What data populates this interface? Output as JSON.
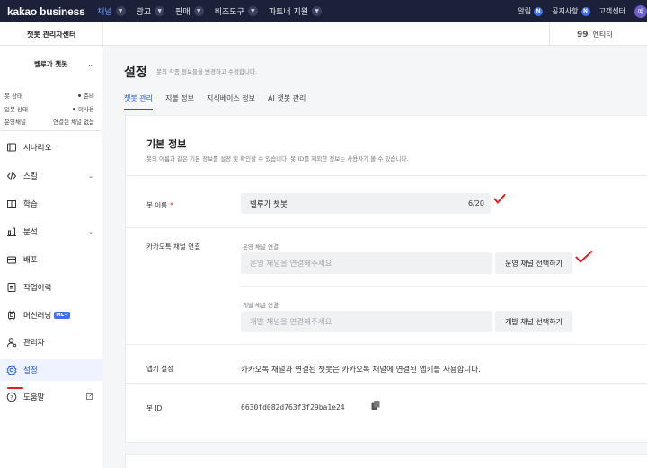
{
  "topnav": {
    "brand": "kakao business",
    "menu": [
      {
        "label": "채널",
        "active": true
      },
      {
        "label": "광고",
        "active": false
      },
      {
        "label": "판매",
        "active": false
      },
      {
        "label": "비즈도구",
        "active": false
      },
      {
        "label": "파트너 지원",
        "active": false
      }
    ],
    "right": {
      "alert_label": "알림",
      "alert_badge": "N",
      "notice_label": "공지사항",
      "notice_badge": "N",
      "support_label": "고객센터",
      "avatar_letter": "예"
    }
  },
  "subheader": {
    "admin_title": "챗봇 관리자센터",
    "entity_icon": "99",
    "entity_label": "엔티티"
  },
  "sidebar": {
    "bot_name": "벨루가 챗봇",
    "status": [
      {
        "label": "봇 상태",
        "value": "준비",
        "dot": true
      },
      {
        "label": "일봇 상태",
        "value": "미사용",
        "dot": true
      },
      {
        "label": "운영채널",
        "value": "연결된 채널 없음",
        "dot": false
      }
    ],
    "items": [
      {
        "label": "시나리오",
        "icon": "scenario-icon",
        "chevron": false,
        "active": false
      },
      {
        "label": "스킬",
        "icon": "code-icon",
        "chevron": true,
        "active": false
      },
      {
        "label": "학습",
        "icon": "book-icon",
        "chevron": false,
        "active": false
      },
      {
        "label": "분석",
        "icon": "chart-icon",
        "chevron": true,
        "active": false
      },
      {
        "label": "배포",
        "icon": "deploy-icon",
        "chevron": false,
        "active": false
      },
      {
        "label": "작업이력",
        "icon": "history-icon",
        "chevron": false,
        "active": false
      },
      {
        "label": "머신러닝",
        "icon": "ml-icon",
        "chevron": false,
        "active": false,
        "badge": "ML+"
      },
      {
        "label": "관리자",
        "icon": "admin-icon",
        "chevron": false,
        "active": false
      },
      {
        "label": "설정",
        "icon": "gear-icon",
        "chevron": false,
        "active": true
      },
      {
        "label": "도움말",
        "icon": "help-icon",
        "chevron": false,
        "active": false,
        "external": true
      }
    ]
  },
  "main": {
    "title": "설정",
    "description": "봇의 각종 정보들을 변경하고 수정합니다.",
    "tabs": [
      {
        "label": "챗봇 관리",
        "active": true
      },
      {
        "label": "지불 정보",
        "active": false
      },
      {
        "label": "지식베이스 정보",
        "active": false
      },
      {
        "label": "AI 챗봇 관리",
        "active": false
      }
    ],
    "basic": {
      "title": "기본 정보",
      "description": "봇의 이름과 같은 기본 정보를 설정 및 확인할 수 있습니다. 봇 ID를 제외한 정보는 사용자가 볼 수 있습니다.",
      "bot_name_label": "봇 이름",
      "required_mark": "*",
      "bot_name_value": "벨루가 챗봇",
      "bot_name_counter": "6/20",
      "channel_label": "카카오톡 채널 연결",
      "op_channel_label": "운영 채널 연결",
      "op_channel_placeholder": "운영 채널을 연결해주세요",
      "op_channel_button": "운영 채널 선택하기",
      "dev_channel_label": "개발 채널 연결",
      "dev_channel_placeholder": "개발 채널을 연결해주세요",
      "dev_channel_button": "개발 채널 선택하기",
      "app_key_label": "앱키 설정",
      "app_key_text": "카카오톡 채널과 연결된 챗봇은 카카오톡 채널에 연결된 앱키를 사용합니다.",
      "bot_id_label": "봇 ID",
      "bot_id_value": "6630fd082d763f3f29ba1e24"
    }
  },
  "colors": {
    "nav_bg": "#1c2038",
    "accent": "#1c57e0",
    "annotation_red": "#e02020"
  }
}
